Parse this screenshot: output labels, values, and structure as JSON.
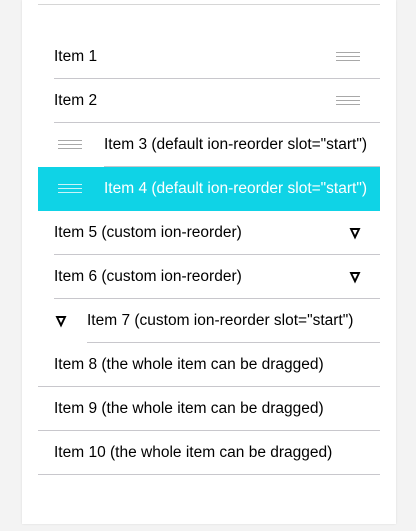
{
  "items": [
    {
      "label": "Item 1"
    },
    {
      "label": "Item 2"
    },
    {
      "label": "Item 3 (default ion-reorder slot=\"start\")"
    },
    {
      "label": "Item 4 (default ion-reorder slot=\"start\")"
    },
    {
      "label": "Item 5 (custom ion-reorder)"
    },
    {
      "label": "Item 6 (custom ion-reorder)"
    },
    {
      "label": "Item 7 (custom ion-reorder slot=\"start\")"
    },
    {
      "label": "Item 8 (the whole item can be dragged)"
    },
    {
      "label": "Item 9 (the whole item can be dragged)"
    },
    {
      "label": "Item 10 (the whole item can be dragged)"
    }
  ],
  "icons": {
    "reorder": "reorder-lines-icon",
    "custom": "shield-icon"
  },
  "colors": {
    "active_background": "#0fd3e6",
    "separator": "#c8c7cc",
    "handle": "#a8a8a8"
  }
}
